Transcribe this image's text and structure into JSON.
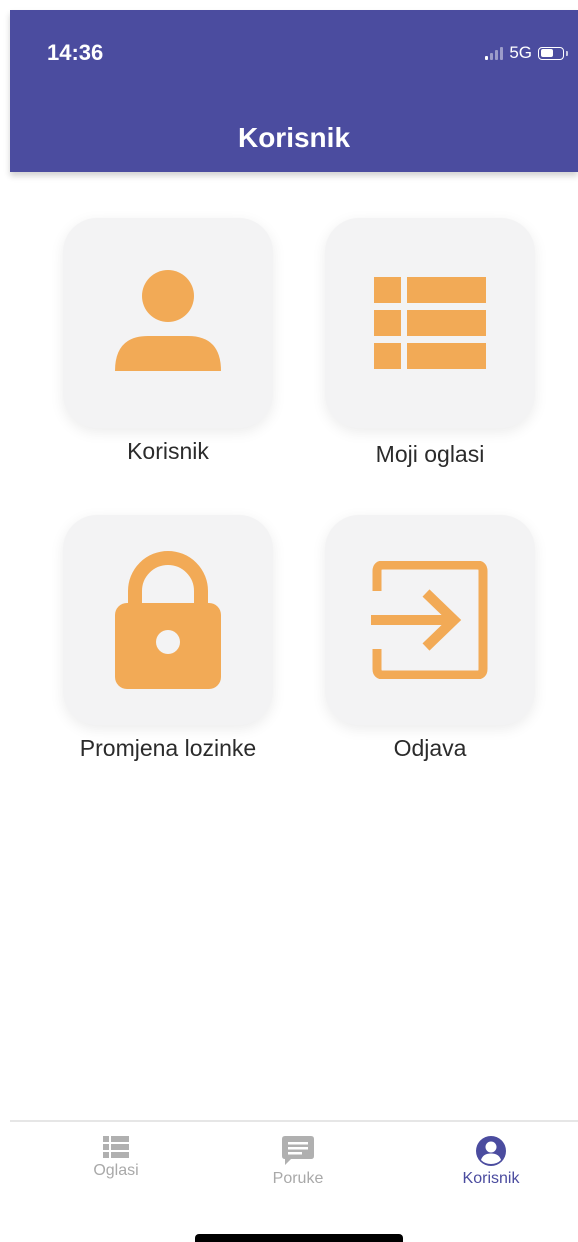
{
  "status_bar": {
    "time": "14:36",
    "network": "5G",
    "battery_level": 0.6
  },
  "header": {
    "title": "Korisnik"
  },
  "tiles": [
    {
      "label": "Korisnik",
      "icon": "user-icon"
    },
    {
      "label": "Moji oglasi",
      "icon": "list-icon"
    },
    {
      "label": "Promjena lozinke",
      "icon": "lock-icon"
    },
    {
      "label": "Odjava",
      "icon": "logout-icon"
    }
  ],
  "tab_bar": {
    "tabs": [
      {
        "label": "Oglasi",
        "icon": "list-icon",
        "active": false
      },
      {
        "label": "Poruke",
        "icon": "message-icon",
        "active": false
      },
      {
        "label": "Korisnik",
        "icon": "user-circle-icon",
        "active": true
      }
    ]
  },
  "colors": {
    "header": "#4b4c9f",
    "accent": "#f2aa56",
    "tile_bg": "#f3f3f4",
    "inactive": "#a9a9a9"
  }
}
